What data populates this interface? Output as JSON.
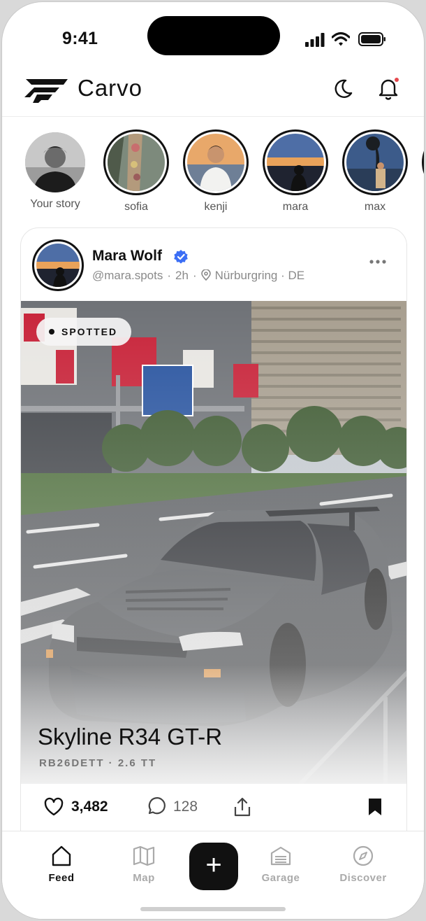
{
  "status_bar": {
    "time": "9:41"
  },
  "header": {
    "brand": "Carvo",
    "icons": [
      "logo-icon",
      "moon-icon",
      "bell-icon"
    ],
    "has_notification": true
  },
  "stories": [
    {
      "name": "Your story"
    },
    {
      "name": "sofia"
    },
    {
      "name": "kenji"
    },
    {
      "name": "mara"
    },
    {
      "name": "max"
    }
  ],
  "post": {
    "author": "Mara Wolf",
    "handle": "@mara.spots",
    "age": "2h",
    "location": "Nürburgring · DE",
    "badge": "SPOTTED",
    "car_title": "Skyline R34 GT-R",
    "car_subtitle": "RB26DETT · 2.6 TT",
    "likes": "3,482",
    "comments": "128",
    "colors": {
      "verified": "#3b6ef5",
      "notification_dot": "#e5484d"
    }
  },
  "tabbar": {
    "tabs": [
      {
        "label": "Feed",
        "icon": "home-icon",
        "active": true
      },
      {
        "label": "Map",
        "icon": "map-icon",
        "active": false
      },
      {
        "label": "Garage",
        "icon": "garage-icon",
        "active": false
      },
      {
        "label": "Discover",
        "icon": "compass-icon",
        "active": false
      }
    ],
    "fab_label": "+"
  }
}
